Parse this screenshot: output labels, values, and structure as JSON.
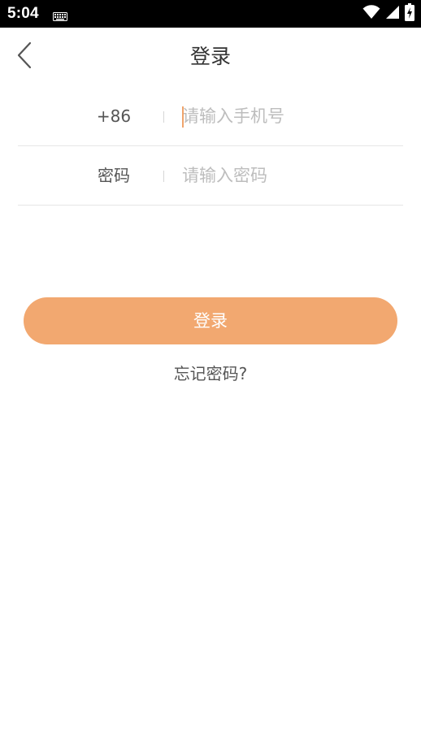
{
  "status_bar": {
    "time": "5:04",
    "icons": [
      "keyboard-icon",
      "wifi-icon",
      "signal-icon",
      "battery-charging-icon"
    ]
  },
  "header": {
    "title": "登录",
    "back_icon": "chevron-left-icon"
  },
  "form": {
    "phone": {
      "label": "+86",
      "value": "",
      "placeholder": "请输入手机号"
    },
    "password": {
      "label": "密码",
      "value": "",
      "placeholder": "请输入密码"
    }
  },
  "actions": {
    "login_label": "登录",
    "forgot_label": "忘记密码?"
  },
  "colors": {
    "accent": "#f2a870",
    "caret": "#f0a46c",
    "text": "#333333",
    "placeholder": "#bdbdbd",
    "divider": "#e6e6e6",
    "status_bar": "#000000"
  }
}
